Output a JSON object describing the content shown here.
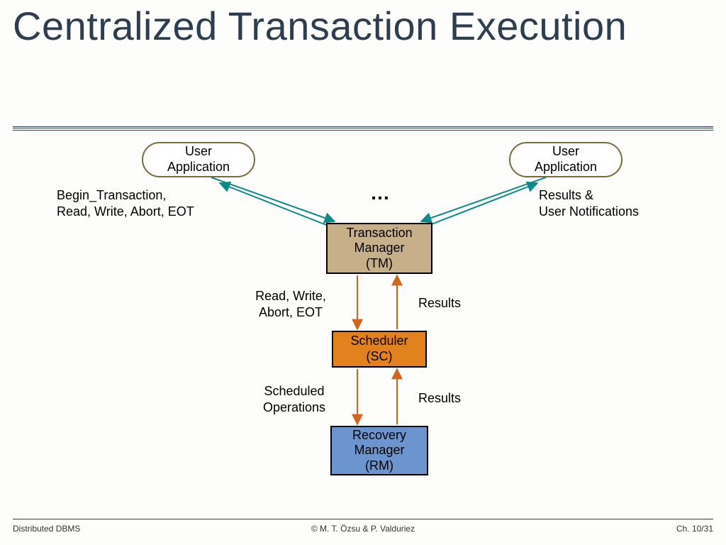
{
  "title": "Centralized Transaction Execution",
  "nodes": {
    "user_app_left": "User\nApplication",
    "user_app_right": "User\nApplication",
    "tm": "Transaction\nManager\n(TM)",
    "sc": "Scheduler\n(SC)",
    "rm": "Recovery\nManager\n(RM)"
  },
  "labels": {
    "begin_trans": "Begin_Transaction,\nRead, Write, Abort, EOT",
    "results_notif": "Results &\nUser Notifications",
    "ellipsis": "…",
    "read_write": "Read, Write,\nAbort, EOT",
    "results1": "Results",
    "scheduled_ops": "Scheduled\nOperations",
    "results2": "Results"
  },
  "footer": {
    "left": "Distributed DBMS",
    "center": "© M. T. Özsu & P. Valduriez",
    "right": "Ch. 10/31"
  },
  "colors": {
    "title": "#2d3e50",
    "tm_fill": "#c7b089",
    "sc_fill": "#e2821f",
    "rm_fill": "#6c94cf",
    "arrow_teal": "#0a8a8a",
    "arrow_orange": "#d4651d"
  }
}
